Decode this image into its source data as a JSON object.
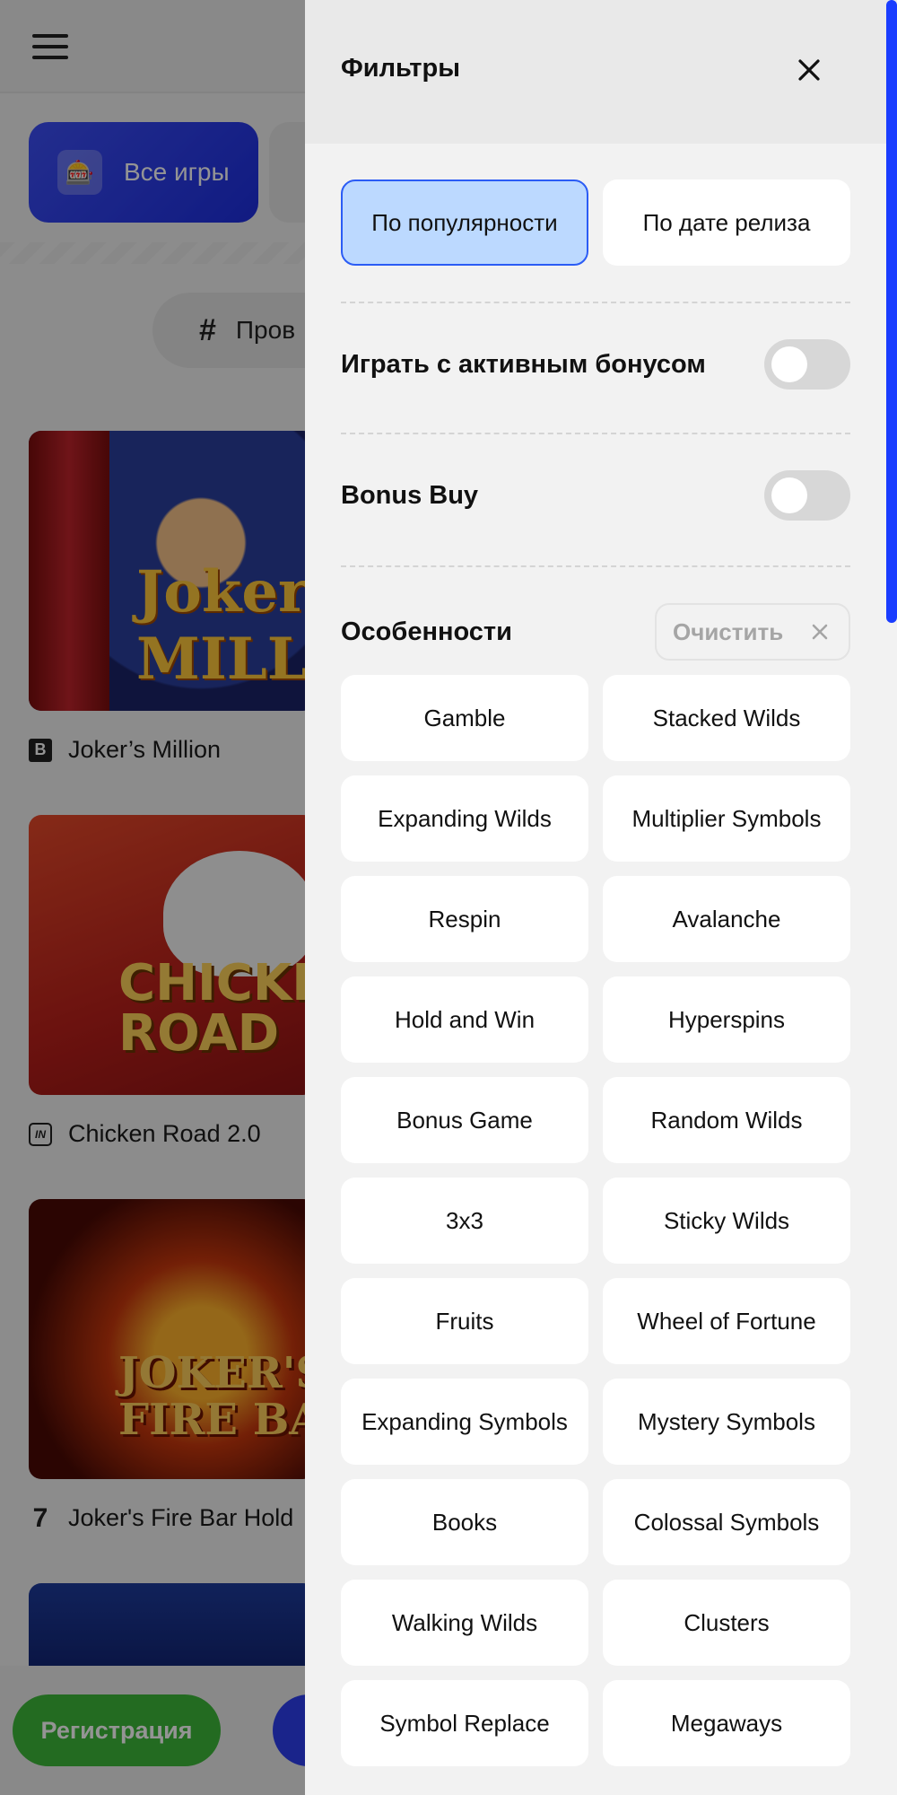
{
  "background": {
    "categories": {
      "all_games_label": "Все игры"
    },
    "providers_label": "Пров",
    "games": [
      {
        "title": "Joker’s Million",
        "provider_icon": "B",
        "art_text": "Joker's MILLION"
      },
      {
        "title": "Chicken Road 2.0",
        "provider_icon": "IN",
        "art_text": "CHICKEN ROAD"
      },
      {
        "title": "Joker's Fire Bar Hold",
        "provider_icon": "7",
        "art_text": "JOKER'S FIRE BA"
      }
    ],
    "register_label": "Регистрация"
  },
  "filters": {
    "title": "Фильтры",
    "sort": {
      "popularity_label": "По популярности",
      "release_date_label": "По дате релиза",
      "active": "popularity"
    },
    "active_bonus": {
      "label": "Играть с активным бонусом",
      "enabled": false
    },
    "bonus_buy": {
      "label": "Bonus Buy",
      "enabled": false
    },
    "features": {
      "title": "Особенности",
      "clear_label": "Очистить",
      "items": [
        "Gamble",
        "Stacked Wilds",
        "Expanding Wilds",
        "Multiplier Symbols",
        "Respin",
        "Avalanche",
        "Hold and Win",
        "Hyperspins",
        "Bonus Game",
        "Random Wilds",
        "3x3",
        "Sticky Wilds",
        "Fruits",
        "Wheel of Fortune",
        "Expanding Symbols",
        "Mystery Symbols",
        "Books",
        "Colossal Symbols",
        "Walking Wilds",
        "Clusters",
        "Symbol Replace",
        "Megaways"
      ]
    }
  },
  "colors": {
    "accent_blue": "#2b5cf5",
    "active_sort_bg": "#bcd9ff",
    "register_green": "#3db83a",
    "scrollbar": "#1a3dff"
  }
}
